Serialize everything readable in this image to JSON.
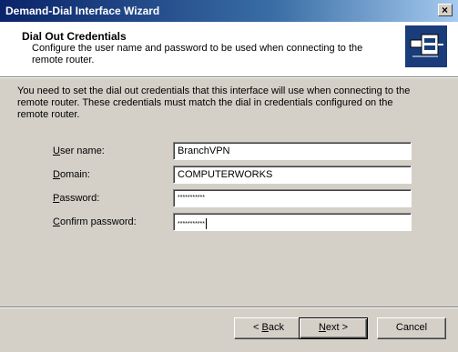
{
  "window": {
    "title": "Demand-Dial Interface Wizard",
    "close_glyph": "×"
  },
  "header": {
    "title": "Dial Out Credentials",
    "subtitle": "Configure the user name and password to be used when connecting to the remote router.",
    "icon": "network-cable-icon"
  },
  "intro": "You need to set the dial out credentials that this interface will use when connecting to the remote router.  These credentials must match the dial in credentials configured on the remote router.",
  "form": {
    "username": {
      "label_u": "U",
      "label_rest": "ser name:",
      "value": "BranchVPN"
    },
    "domain": {
      "label_u": "D",
      "label_rest": "omain:",
      "value": "COMPUTERWORKS"
    },
    "password": {
      "label_u": "P",
      "label_rest": "assword:",
      "value": "***********"
    },
    "confirm": {
      "label_u": "C",
      "label_rest": "onfirm password:",
      "value": "***********"
    }
  },
  "buttons": {
    "back_prefix": "< ",
    "back_u": "B",
    "back_rest": "ack",
    "next_u": "N",
    "next_rest": "ext >",
    "cancel": "Cancel"
  }
}
